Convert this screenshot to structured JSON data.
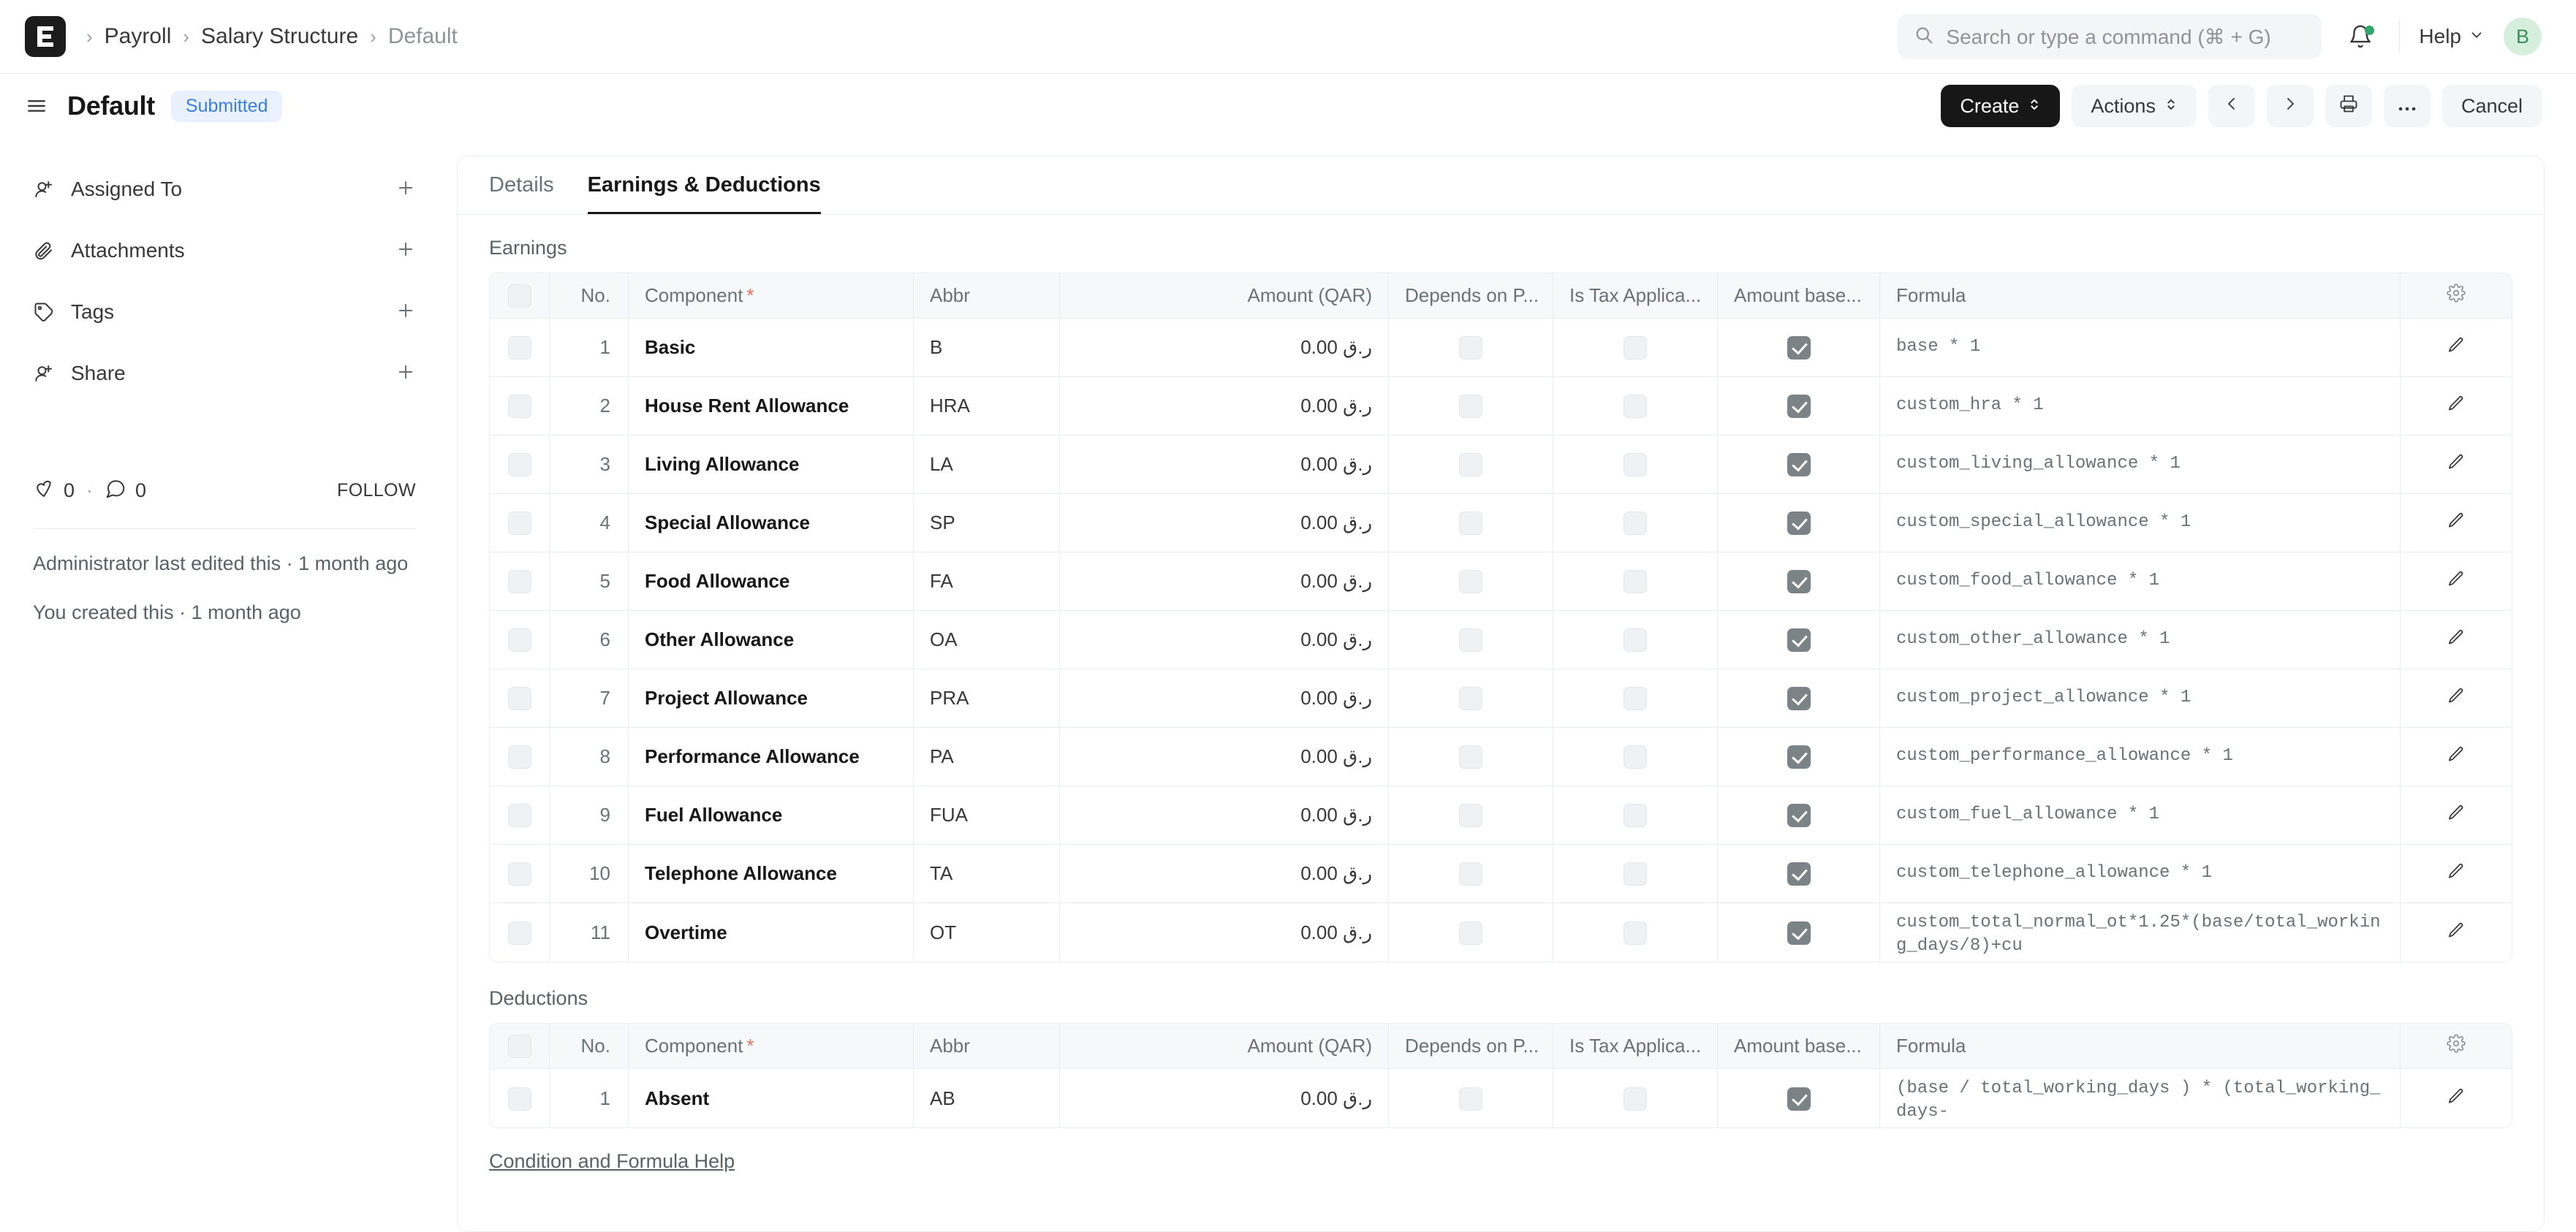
{
  "navbar": {
    "breadcrumb": [
      {
        "label": "Payroll",
        "muted": false
      },
      {
        "label": "Salary Structure",
        "muted": false
      },
      {
        "label": "Default",
        "muted": true
      }
    ],
    "search_placeholder": "Search or type a command (⌘ + G)",
    "help_label": "Help",
    "avatar_initial": "B",
    "notification_dot_color": "#30a66d"
  },
  "pagehead": {
    "title": "Default",
    "status_badge": "Submitted",
    "status_badge_color": "#3e7fdd",
    "buttons": {
      "create": "Create",
      "actions": "Actions",
      "cancel": "Cancel"
    }
  },
  "sidebar": {
    "items": [
      {
        "label": "Assigned To",
        "icon": "user-plus-icon",
        "action": "+"
      },
      {
        "label": "Attachments",
        "icon": "paperclip-icon",
        "action": "+"
      },
      {
        "label": "Tags",
        "icon": "tag-icon",
        "action": "+"
      },
      {
        "label": "Share",
        "icon": "user-plus-icon",
        "action": "+"
      }
    ],
    "likes_count": "0",
    "comments_count": "0",
    "separator_dot": "·",
    "follow_label": "FOLLOW",
    "edited_meta": "Administrator last edited this · 1 month ago",
    "created_meta": "You created this · 1 month ago"
  },
  "tabs": [
    {
      "label": "Details",
      "active": false
    },
    {
      "label": "Earnings & Deductions",
      "active": true
    }
  ],
  "earnings": {
    "section_label": "Earnings",
    "columns": {
      "no": "No.",
      "component": "Component",
      "component_required": "*",
      "abbr": "Abbr",
      "amount": "Amount (QAR)",
      "depends": "Depends on P...",
      "tax": "Is Tax Applica...",
      "base": "Amount base...",
      "formula": "Formula"
    },
    "rows": [
      {
        "no": "1",
        "component": "Basic",
        "abbr": "B",
        "amount": "0.00 ر.ق",
        "depends": false,
        "tax": false,
        "base": true,
        "formula": "base * 1"
      },
      {
        "no": "2",
        "component": "House Rent Allowance",
        "abbr": "HRA",
        "amount": "0.00 ر.ق",
        "depends": false,
        "tax": false,
        "base": true,
        "formula": "custom_hra * 1"
      },
      {
        "no": "3",
        "component": "Living Allowance",
        "abbr": "LA",
        "amount": "0.00 ر.ق",
        "depends": false,
        "tax": false,
        "base": true,
        "formula": "custom_living_allowance * 1"
      },
      {
        "no": "4",
        "component": "Special Allowance",
        "abbr": "SP",
        "amount": "0.00 ر.ق",
        "depends": false,
        "tax": false,
        "base": true,
        "formula": "custom_special_allowance * 1"
      },
      {
        "no": "5",
        "component": "Food Allowance",
        "abbr": "FA",
        "amount": "0.00 ر.ق",
        "depends": false,
        "tax": false,
        "base": true,
        "formula": "custom_food_allowance * 1"
      },
      {
        "no": "6",
        "component": "Other Allowance",
        "abbr": "OA",
        "amount": "0.00 ر.ق",
        "depends": false,
        "tax": false,
        "base": true,
        "formula": "custom_other_allowance * 1"
      },
      {
        "no": "7",
        "component": "Project Allowance",
        "abbr": "PRA",
        "amount": "0.00 ر.ق",
        "depends": false,
        "tax": false,
        "base": true,
        "formula": "custom_project_allowance * 1"
      },
      {
        "no": "8",
        "component": "Performance Allowance",
        "abbr": "PA",
        "amount": "0.00 ر.ق",
        "depends": false,
        "tax": false,
        "base": true,
        "formula": "custom_performance_allowance * 1"
      },
      {
        "no": "9",
        "component": "Fuel Allowance",
        "abbr": "FUA",
        "amount": "0.00 ر.ق",
        "depends": false,
        "tax": false,
        "base": true,
        "formula": "custom_fuel_allowance * 1"
      },
      {
        "no": "10",
        "component": "Telephone Allowance",
        "abbr": "TA",
        "amount": "0.00 ر.ق",
        "depends": false,
        "tax": false,
        "base": true,
        "formula": "custom_telephone_allowance * 1"
      },
      {
        "no": "11",
        "component": "Overtime",
        "abbr": "OT",
        "amount": "0.00 ر.ق",
        "depends": false,
        "tax": false,
        "base": true,
        "formula": "custom_total_normal_ot*1.25*(base/total_working_days/8)+cu"
      }
    ]
  },
  "deductions": {
    "section_label": "Deductions",
    "columns": {
      "no": "No.",
      "component": "Component",
      "component_required": "*",
      "abbr": "Abbr",
      "amount": "Amount (QAR)",
      "depends": "Depends on P...",
      "tax": "Is Tax Applica...",
      "base": "Amount base...",
      "formula": "Formula"
    },
    "rows": [
      {
        "no": "1",
        "component": "Absent",
        "abbr": "AB",
        "amount": "0.00 ر.ق",
        "depends": false,
        "tax": false,
        "base": true,
        "formula": "(base / total_working_days ) * (total_working_days-"
      }
    ]
  },
  "footer": {
    "help_link": "Condition and Formula Help"
  }
}
